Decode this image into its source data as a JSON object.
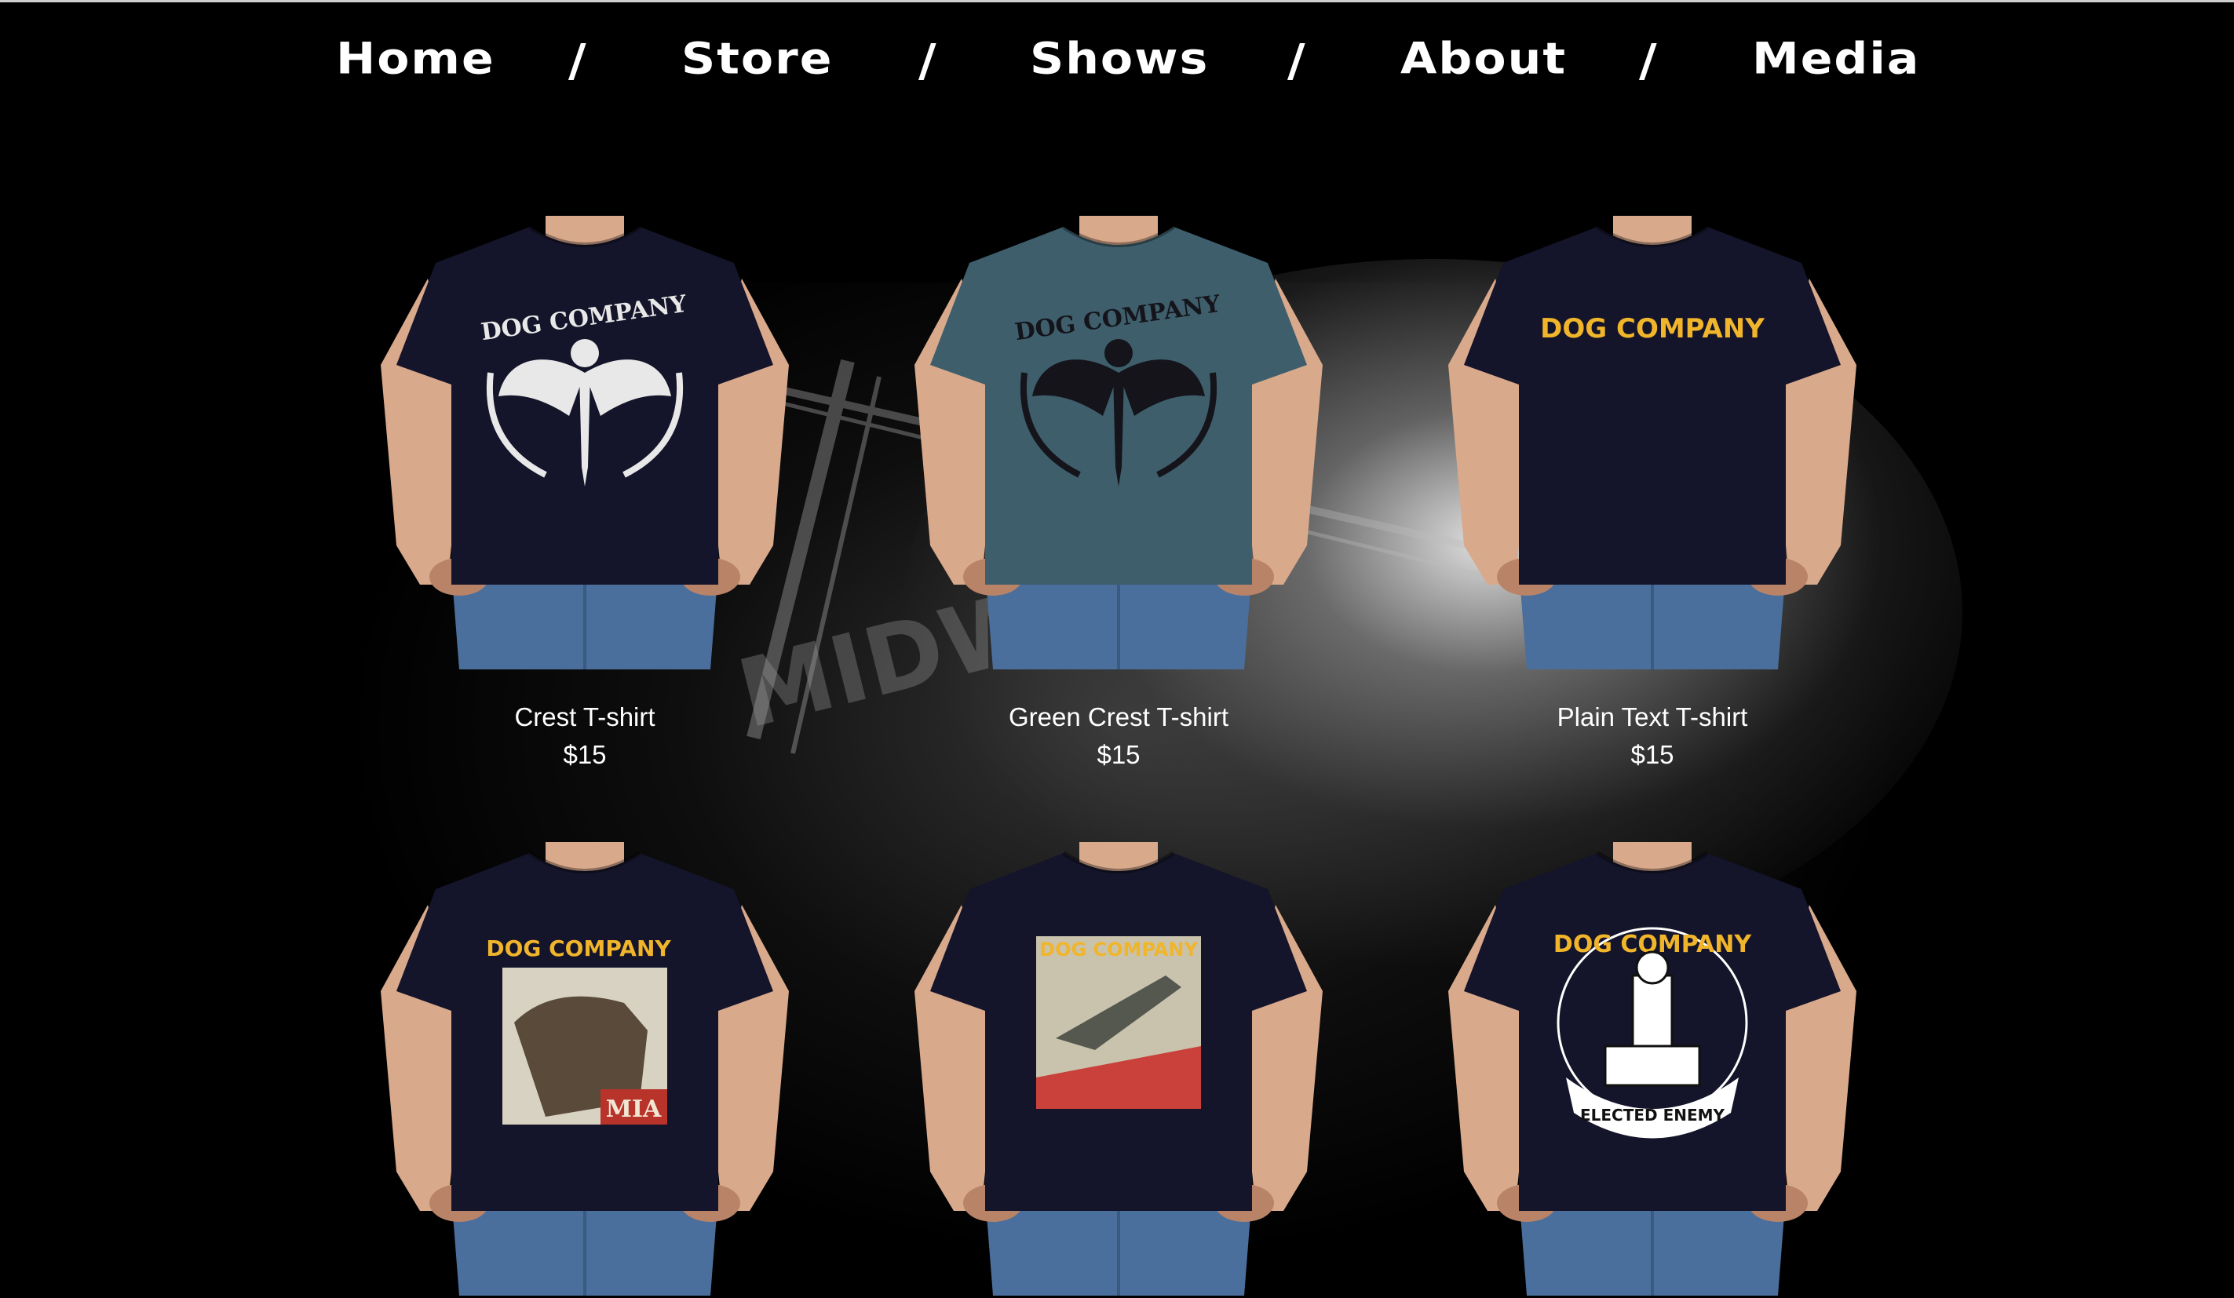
{
  "nav": {
    "items": [
      "Home",
      "Store",
      "Shows",
      "About",
      "Media"
    ],
    "separator": "/"
  },
  "background": {
    "band_logo_text": "MIDWEST"
  },
  "products": [
    {
      "name": "Crest T-shirt",
      "price": "$15",
      "shirt_color": "#14142a",
      "design": "crest",
      "design_color": "#e8e8e8",
      "design_text": "DOG COMPANY"
    },
    {
      "name": "Green Crest T-shirt",
      "price": "$15",
      "shirt_color": "#3e5e6c",
      "design": "crest",
      "design_color": "#14141a",
      "design_text": "DOG COMPANY"
    },
    {
      "name": "Plain Text T-shirt",
      "price": "$15",
      "shirt_color": "#14142a",
      "design": "text",
      "design_color": "#f0b52a",
      "design_text": "DOG COMPANY"
    },
    {
      "name": "",
      "price": "",
      "shirt_color": "#14142a",
      "design": "mia",
      "design_color": "#f0b52a",
      "design_text": "DOG COMPANY",
      "design_subtext": "MIA"
    },
    {
      "name": "",
      "price": "",
      "shirt_color": "#14142a",
      "design": "plane",
      "design_color": "#f0b52a",
      "design_text": "DOG COMPANY"
    },
    {
      "name": "",
      "price": "",
      "shirt_color": "#14142a",
      "design": "elected",
      "design_color": "#f0b52a",
      "design_text": "DOG COMPANY",
      "design_subtext": "ELECTED ENEMY"
    }
  ]
}
